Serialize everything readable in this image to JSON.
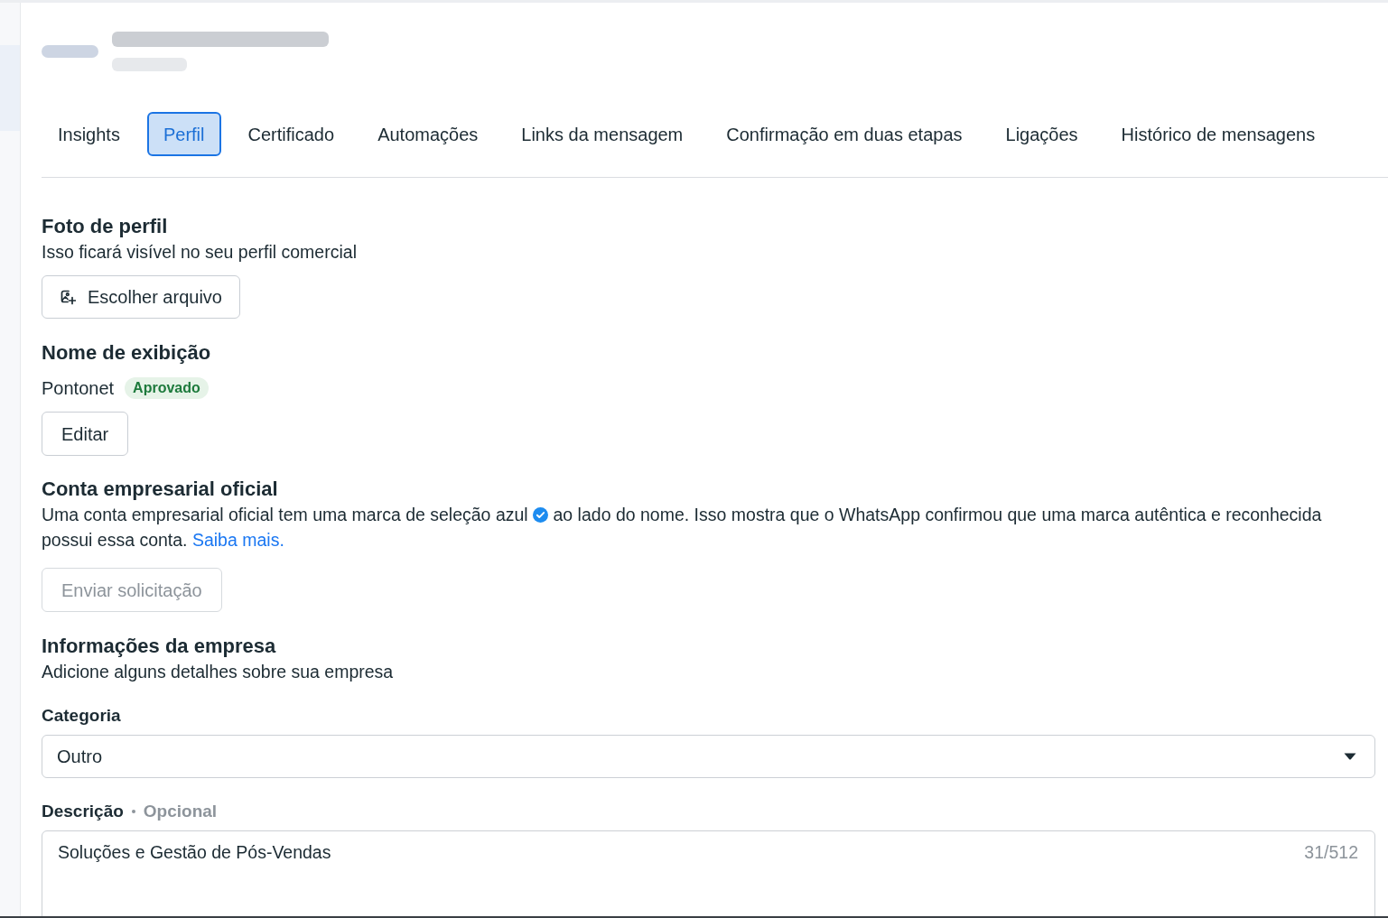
{
  "tabs": [
    {
      "label": "Insights",
      "selected": false
    },
    {
      "label": "Perfil",
      "selected": true
    },
    {
      "label": "Certificado",
      "selected": false
    },
    {
      "label": "Automações",
      "selected": false
    },
    {
      "label": "Links da mensagem",
      "selected": false
    },
    {
      "label": "Confirmação em duas etapas",
      "selected": false
    },
    {
      "label": "Ligações",
      "selected": false
    },
    {
      "label": "Histórico de mensagens",
      "selected": false
    }
  ],
  "profile_photo": {
    "title": "Foto de perfil",
    "subtitle": "Isso ficará visível no seu perfil comercial",
    "button": "Escolher arquivo"
  },
  "display_name": {
    "title": "Nome de exibição",
    "name": "Pontonet",
    "status": "Aprovado",
    "button": "Editar"
  },
  "official_account": {
    "title": "Conta empresarial oficial",
    "text_before_icon": "Uma conta empresarial oficial tem uma marca de seleção azul",
    "text_after_icon": "ao lado do nome. Isso mostra que o WhatsApp confirmou que uma marca autêntica e reconhecida possui essa conta.",
    "link": "Saiba mais.",
    "button": {
      "label": "Enviar solicitação",
      "disabled": true
    }
  },
  "business_info": {
    "title": "Informações da empresa",
    "subtitle": "Adicione alguns detalhes sobre sua empresa",
    "category": {
      "label": "Categoria",
      "value": "Outro"
    },
    "description": {
      "label": "Descrição",
      "optional_label": "Opcional",
      "value": "Soluções e Gestão de Pós-Vendas",
      "counter": "31/512"
    }
  }
}
